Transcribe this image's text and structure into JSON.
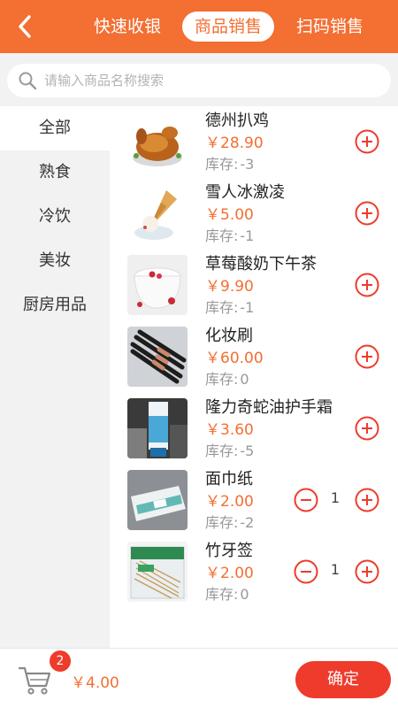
{
  "colors": {
    "accent": "#f36f32",
    "confirm": "#ee3b2c"
  },
  "header": {
    "tabs": [
      {
        "label": "快速收银",
        "active": false
      },
      {
        "label": "商品销售",
        "active": true
      },
      {
        "label": "扫码销售",
        "active": false
      }
    ]
  },
  "search": {
    "placeholder": "请输入商品名称搜索",
    "value": ""
  },
  "sidebar": {
    "categories": [
      {
        "label": "全部",
        "active": true
      },
      {
        "label": "熟食",
        "active": false
      },
      {
        "label": "冷饮",
        "active": false
      },
      {
        "label": "美妆",
        "active": false
      },
      {
        "label": "厨房用品",
        "active": false
      }
    ]
  },
  "products": [
    {
      "name": "德州扒鸡",
      "price": "￥28.90",
      "stock_label": "库存:",
      "stock": "-3",
      "qty": null,
      "image": "roast-chicken"
    },
    {
      "name": "雪人冰激凌",
      "price": "￥5.00",
      "stock_label": "库存:",
      "stock": "-1",
      "qty": null,
      "image": "ice-cream-cone"
    },
    {
      "name": "草莓酸奶下午茶",
      "price": "￥9.90",
      "stock_label": "库存:",
      "stock": "-1",
      "qty": null,
      "image": "yogurt-bowl"
    },
    {
      "name": "化妆刷",
      "price": "￥60.00",
      "stock_label": "库存:",
      "stock": "0",
      "qty": null,
      "image": "makeup-brushes"
    },
    {
      "name": "隆力奇蛇油护手霜",
      "price": "￥3.60",
      "stock_label": "库存:",
      "stock": "-5",
      "qty": null,
      "image": "hand-cream-tube"
    },
    {
      "name": "面巾纸",
      "price": "￥2.00",
      "stock_label": "库存:",
      "stock": "-2",
      "qty": "1",
      "image": "tissue-pack"
    },
    {
      "name": "竹牙签",
      "price": "￥2.00",
      "stock_label": "库存:",
      "stock": "0",
      "qty": "1",
      "image": "toothpick-pack"
    }
  ],
  "footer": {
    "cart_count": "2",
    "total": "￥4.00",
    "confirm_label": "确定"
  }
}
